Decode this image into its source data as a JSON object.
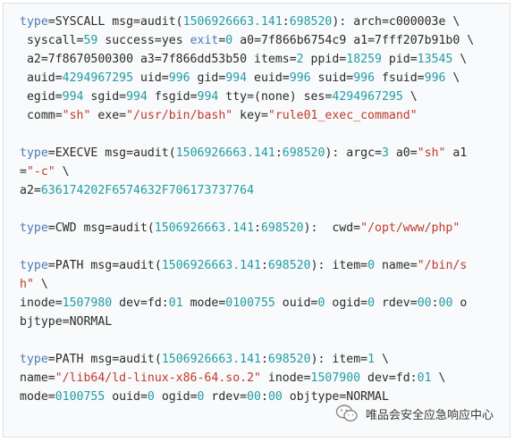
{
  "colors": {
    "background": "#f9fafb",
    "border": "#dfe1e4",
    "keyword": "#4a79b8",
    "number": "#1f9da4",
    "string": "#c0392b",
    "plain": "#2a2a2a"
  },
  "code_lines": [
    [
      [
        "kw",
        "type"
      ],
      [
        "pl",
        "=SYSCALL msg=audit("
      ],
      [
        "num",
        "1506926663.141"
      ],
      [
        "pl",
        ":"
      ],
      [
        "num",
        "698520"
      ],
      [
        "pl",
        "): arch=c000003e \\"
      ]
    ],
    [
      [
        "pl",
        " syscall="
      ],
      [
        "num",
        "59"
      ],
      [
        "pl",
        " success=yes "
      ],
      [
        "kw",
        "exit"
      ],
      [
        "pl",
        "="
      ],
      [
        "num",
        "0"
      ],
      [
        "pl",
        " a0=7f866b6754c9 a1=7fff207b91b0 \\"
      ]
    ],
    [
      [
        "pl",
        " a2=7f8670500300 a3=7f866dd53b50 items="
      ],
      [
        "num",
        "2"
      ],
      [
        "pl",
        " ppid="
      ],
      [
        "num",
        "18259"
      ],
      [
        "pl",
        " pid="
      ],
      [
        "num",
        "13545"
      ],
      [
        "pl",
        " \\"
      ]
    ],
    [
      [
        "pl",
        " auid="
      ],
      [
        "num",
        "4294967295"
      ],
      [
        "pl",
        " uid="
      ],
      [
        "num",
        "996"
      ],
      [
        "pl",
        " gid="
      ],
      [
        "num",
        "994"
      ],
      [
        "pl",
        " euid="
      ],
      [
        "num",
        "996"
      ],
      [
        "pl",
        " suid="
      ],
      [
        "num",
        "996"
      ],
      [
        "pl",
        " fsuid="
      ],
      [
        "num",
        "996"
      ],
      [
        "pl",
        " \\"
      ]
    ],
    [
      [
        "pl",
        " egid="
      ],
      [
        "num",
        "994"
      ],
      [
        "pl",
        " sgid="
      ],
      [
        "num",
        "994"
      ],
      [
        "pl",
        " fsgid="
      ],
      [
        "num",
        "994"
      ],
      [
        "pl",
        " tty=(none) ses="
      ],
      [
        "num",
        "4294967295"
      ],
      [
        "pl",
        " \\"
      ]
    ],
    [
      [
        "pl",
        " comm="
      ],
      [
        "str",
        "\"sh\""
      ],
      [
        "pl",
        " exe="
      ],
      [
        "str",
        "\"/usr/bin/bash\""
      ],
      [
        "pl",
        " key="
      ],
      [
        "str",
        "\"rule01_exec_command\""
      ]
    ],
    [],
    [
      [
        "kw",
        "type"
      ],
      [
        "pl",
        "=EXECVE msg=audit("
      ],
      [
        "num",
        "1506926663.141"
      ],
      [
        "pl",
        ":"
      ],
      [
        "num",
        "698520"
      ],
      [
        "pl",
        "): argc="
      ],
      [
        "num",
        "3"
      ],
      [
        "pl",
        " a0="
      ],
      [
        "str",
        "\"sh\""
      ],
      [
        "pl",
        " a1"
      ]
    ],
    [
      [
        "pl",
        "="
      ],
      [
        "str",
        "\"-c\""
      ],
      [
        "pl",
        " \\"
      ]
    ],
    [
      [
        "pl",
        "a2="
      ],
      [
        "num",
        "636174202F6574632F706173737764"
      ]
    ],
    [],
    [
      [
        "kw",
        "type"
      ],
      [
        "pl",
        "=CWD msg=audit("
      ],
      [
        "num",
        "1506926663.141"
      ],
      [
        "pl",
        ":"
      ],
      [
        "num",
        "698520"
      ],
      [
        "pl",
        "):  cwd="
      ],
      [
        "str",
        "\"/opt/www/php\""
      ]
    ],
    [],
    [
      [
        "kw",
        "type"
      ],
      [
        "pl",
        "=PATH msg=audit("
      ],
      [
        "num",
        "1506926663.141"
      ],
      [
        "pl",
        ":"
      ],
      [
        "num",
        "698520"
      ],
      [
        "pl",
        "): item="
      ],
      [
        "num",
        "0"
      ],
      [
        "pl",
        " name="
      ],
      [
        "str",
        "\"/bin/s"
      ]
    ],
    [
      [
        "str",
        "h\""
      ],
      [
        "pl",
        " \\"
      ]
    ],
    [
      [
        "pl",
        "inode="
      ],
      [
        "num",
        "1507980"
      ],
      [
        "pl",
        " dev=fd:"
      ],
      [
        "num",
        "01"
      ],
      [
        "pl",
        " mode="
      ],
      [
        "num",
        "0100755"
      ],
      [
        "pl",
        " ouid="
      ],
      [
        "num",
        "0"
      ],
      [
        "pl",
        " ogid="
      ],
      [
        "num",
        "0"
      ],
      [
        "pl",
        " rdev="
      ],
      [
        "num",
        "00"
      ],
      [
        "pl",
        ":"
      ],
      [
        "num",
        "00"
      ],
      [
        "pl",
        " o"
      ]
    ],
    [
      [
        "pl",
        "bjtype=NORMAL"
      ]
    ],
    [],
    [
      [
        "kw",
        "type"
      ],
      [
        "pl",
        "=PATH msg=audit("
      ],
      [
        "num",
        "1506926663.141"
      ],
      [
        "pl",
        ":"
      ],
      [
        "num",
        "698520"
      ],
      [
        "pl",
        "): item="
      ],
      [
        "num",
        "1"
      ],
      [
        "pl",
        " \\"
      ]
    ],
    [
      [
        "pl",
        "name="
      ],
      [
        "str",
        "\"/lib64/ld-linux-x86-64.so.2\""
      ],
      [
        "pl",
        " inode="
      ],
      [
        "num",
        "1507900"
      ],
      [
        "pl",
        " dev=fd:"
      ],
      [
        "num",
        "01"
      ],
      [
        "pl",
        " \\"
      ]
    ],
    [
      [
        "pl",
        "mode="
      ],
      [
        "num",
        "0100755"
      ],
      [
        "pl",
        " ouid="
      ],
      [
        "num",
        "0"
      ],
      [
        "pl",
        " ogid="
      ],
      [
        "num",
        "0"
      ],
      [
        "pl",
        " rdev="
      ],
      [
        "num",
        "00"
      ],
      [
        "pl",
        ":"
      ],
      [
        "num",
        "00"
      ],
      [
        "pl",
        " objtype=NORMAL"
      ]
    ]
  ],
  "watermark": {
    "icon": "wechat-logo-icon",
    "text": "唯品会安全应急响应中心"
  }
}
